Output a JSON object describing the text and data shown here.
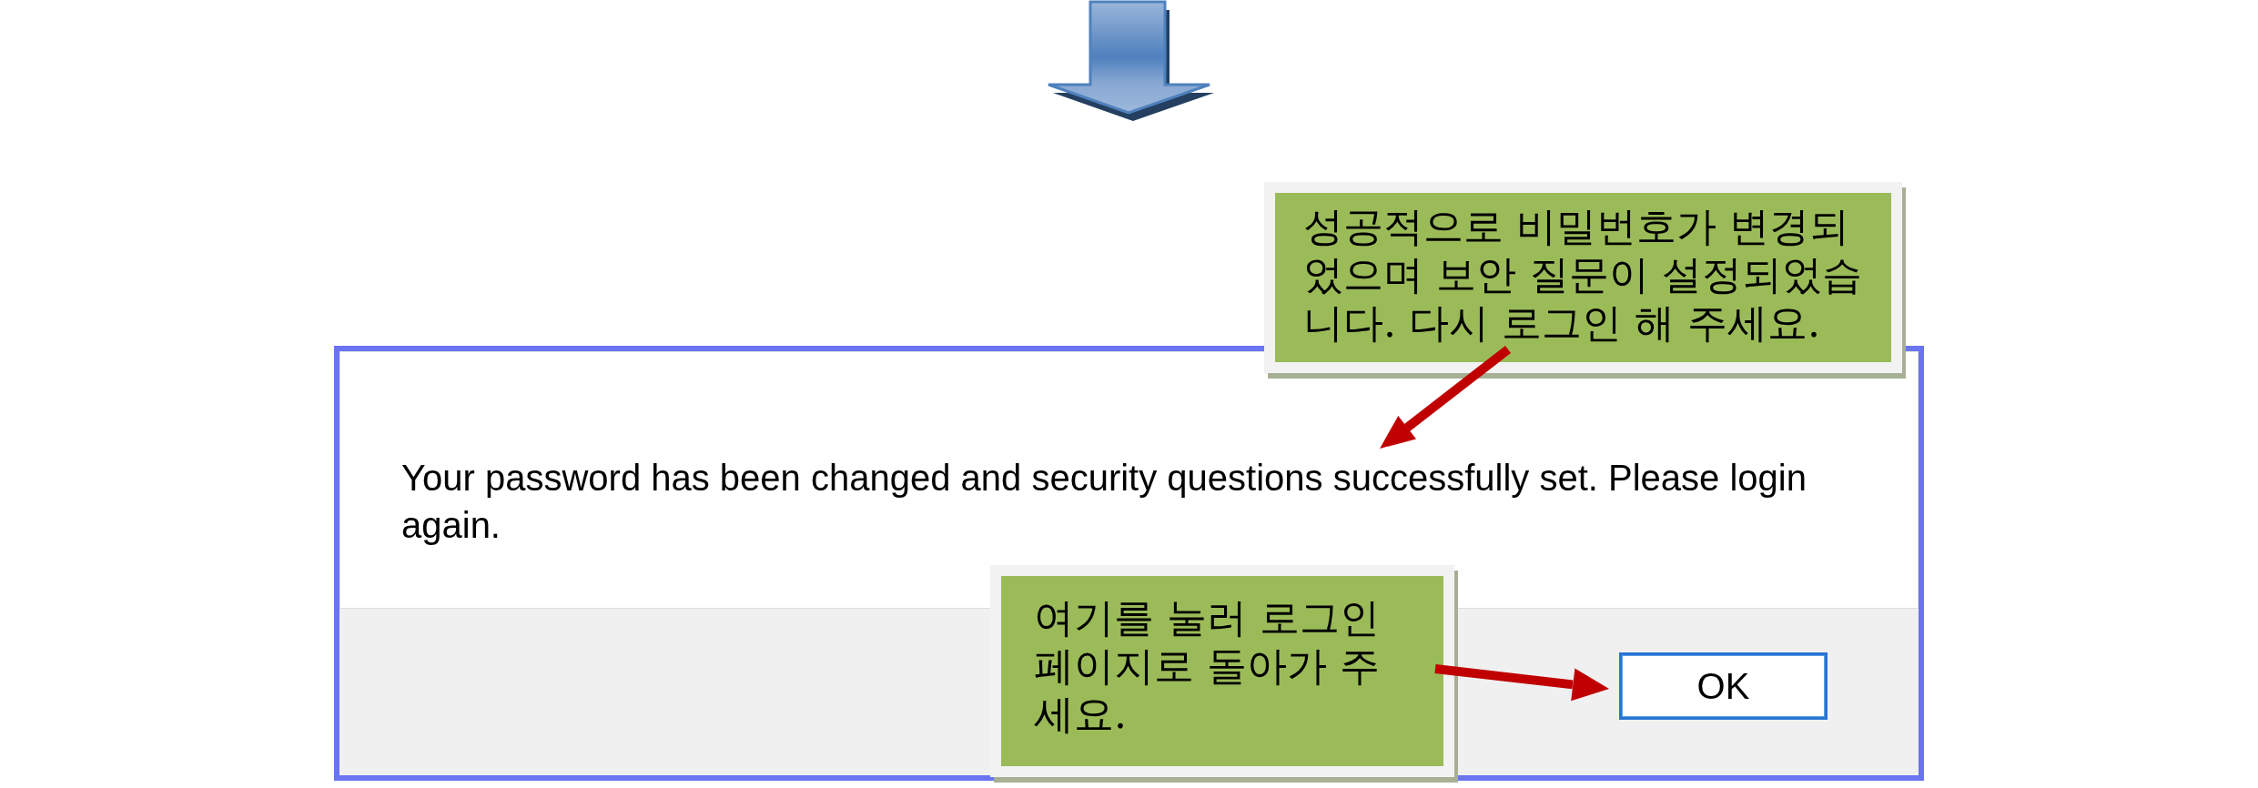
{
  "dialog": {
    "message": "Your password has been changed and security questions successfully set. Please login again.",
    "buttons": [
      {
        "label": "OK",
        "focused": true
      }
    ]
  },
  "callouts": [
    {
      "text": "성공적으로 비밀번호가 변경되었으며 보안 질문이 설정되었습니다. 다시 로그인 해 주세요."
    },
    {
      "text": "여기를 눌러 로그인 페이지로 돌아가 주세요."
    }
  ]
}
